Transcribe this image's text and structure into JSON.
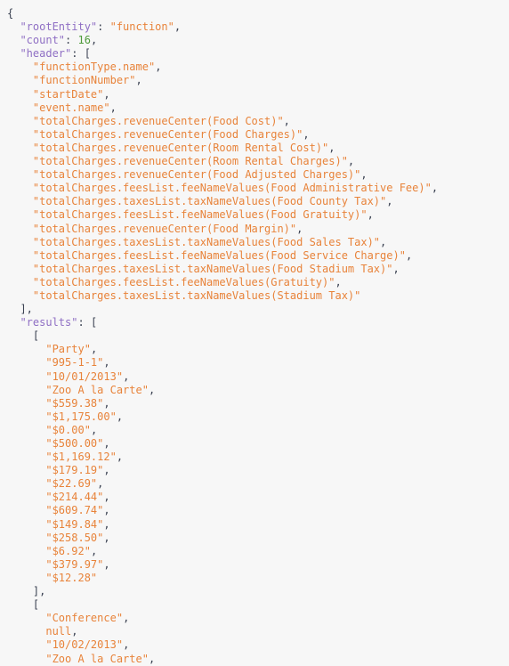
{
  "document": {
    "type": "json",
    "format": "pretty-printed",
    "indent_size": 2,
    "colors": {
      "background": "#f7f7f7",
      "key": "#8f6fc4",
      "string": "#e8833a",
      "number": "#4e9a3a",
      "punctuation": "#3b4252"
    }
  },
  "json": {
    "rootEntity_key": "\"rootEntity\"",
    "rootEntity_value": "\"function\"",
    "count_key": "\"count\"",
    "count_value": "16",
    "header_key": "\"header\"",
    "results_key": "\"results\"",
    "header": [
      "\"functionType.name\"",
      "\"functionNumber\"",
      "\"startDate\"",
      "\"event.name\"",
      "\"totalCharges.revenueCenter(Food Cost)\"",
      "\"totalCharges.revenueCenter(Food Charges)\"",
      "\"totalCharges.revenueCenter(Room Rental Cost)\"",
      "\"totalCharges.revenueCenter(Room Rental Charges)\"",
      "\"totalCharges.revenueCenter(Food Adjusted Charges)\"",
      "\"totalCharges.feesList.feeNameValues(Food Administrative Fee)\"",
      "\"totalCharges.taxesList.taxNameValues(Food County Tax)\"",
      "\"totalCharges.feesList.feeNameValues(Food Gratuity)\"",
      "\"totalCharges.revenueCenter(Food Margin)\"",
      "\"totalCharges.taxesList.taxNameValues(Food Sales Tax)\"",
      "\"totalCharges.feesList.feeNameValues(Food Service Charge)\"",
      "\"totalCharges.taxesList.taxNameValues(Food Stadium Tax)\"",
      "\"totalCharges.feesList.feeNameValues(Gratuity)\"",
      "\"totalCharges.taxesList.taxNameValues(Stadium Tax)\""
    ],
    "results": [
      {
        "values": [
          "\"Party\"",
          "\"995-1-1\"",
          "\"10/01/2013\"",
          "\"Zoo A la Carte\"",
          "\"$559.38\"",
          "\"$1,175.00\"",
          "\"$0.00\"",
          "\"$500.00\"",
          "\"$1,169.12\"",
          "\"$179.19\"",
          "\"$22.69\"",
          "\"$214.44\"",
          "\"$609.74\"",
          "\"$149.84\"",
          "\"$258.50\"",
          "\"$6.92\"",
          "\"$379.97\"",
          "\"$12.28\""
        ]
      },
      {
        "values": [
          "\"Conference\"",
          "null",
          "\"10/02/2013\"",
          "\"Zoo A la Carte\""
        ]
      }
    ]
  },
  "punctuation": {
    "open_brace": "{",
    "open_bracket": "[",
    "close_bracket_comma": "],",
    "colon_space": ": ",
    "comma": ",",
    "indent1": "  ",
    "indent2": "    ",
    "indent3": "      "
  }
}
